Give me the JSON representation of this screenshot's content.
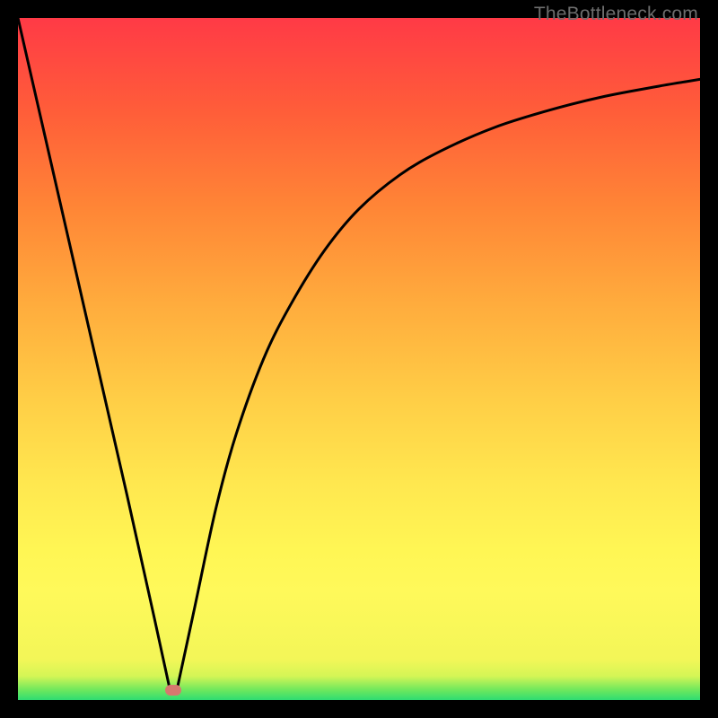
{
  "watermark": "TheBottleneck.com",
  "marker": {
    "cx_frac": 0.228,
    "cy_frac": 0.985
  },
  "chart_data": {
    "type": "line",
    "title": "",
    "xlabel": "",
    "ylabel": "",
    "xlim": [
      0,
      1
    ],
    "ylim": [
      0,
      1
    ],
    "series": [
      {
        "name": "left-branch",
        "x": [
          0.0,
          0.04,
          0.08,
          0.12,
          0.16,
          0.2,
          0.224
        ],
        "y": [
          1.0,
          0.825,
          0.65,
          0.475,
          0.3,
          0.12,
          0.01
        ]
      },
      {
        "name": "right-branch",
        "x": [
          0.232,
          0.26,
          0.29,
          0.32,
          0.36,
          0.4,
          0.45,
          0.5,
          0.56,
          0.62,
          0.7,
          0.78,
          0.86,
          0.94,
          1.0
        ],
        "y": [
          0.01,
          0.14,
          0.28,
          0.39,
          0.5,
          0.58,
          0.66,
          0.72,
          0.77,
          0.805,
          0.84,
          0.865,
          0.885,
          0.9,
          0.91
        ]
      }
    ],
    "annotations": [
      {
        "text": "TheBottleneck.com",
        "position": "top-right"
      }
    ]
  }
}
